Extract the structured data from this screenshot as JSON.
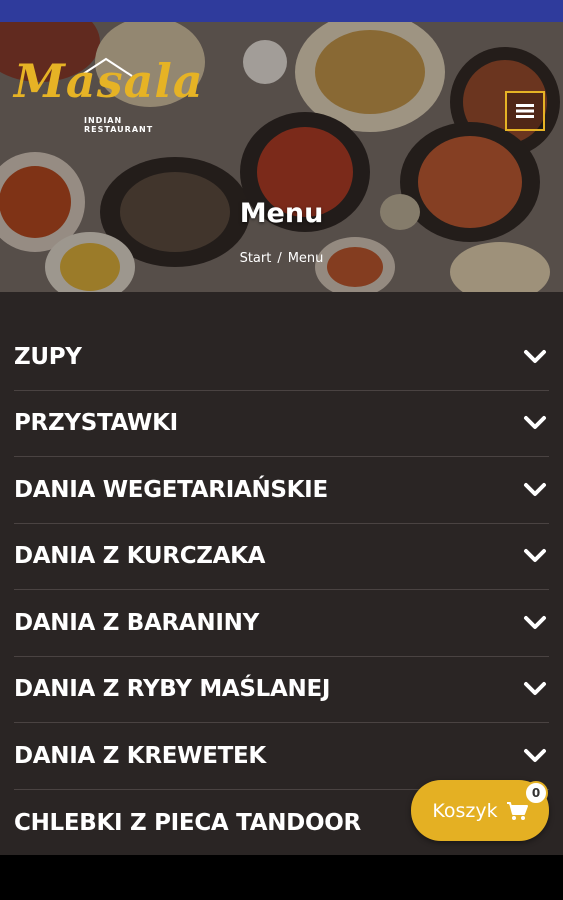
{
  "colors": {
    "accent": "#e4b023",
    "status_bar": "#2f3b9c",
    "menu_background": "#2a2524",
    "divider": "#4a4342"
  },
  "header": {
    "logo_word": "Masala",
    "logo_subtitle": "INDIAN RESTAURANT",
    "menu_icon": "hamburger-icon"
  },
  "hero": {
    "title": "Menu",
    "breadcrumb": {
      "home": "Start",
      "separator": "/",
      "current": "Menu"
    }
  },
  "categories": [
    {
      "label": "ZUPY",
      "icon": "chevron-down-icon"
    },
    {
      "label": "PRZYSTAWKI",
      "icon": "chevron-down-icon"
    },
    {
      "label": "DANIA WEGETARIAŃSKIE",
      "icon": "chevron-down-icon"
    },
    {
      "label": "DANIA Z KURCZAKA",
      "icon": "chevron-down-icon"
    },
    {
      "label": "DANIA Z BARANINY",
      "icon": "chevron-down-icon"
    },
    {
      "label": "DANIA Z RYBY MAŚLANEJ",
      "icon": "chevron-down-icon"
    },
    {
      "label": "DANIA Z KREWETEK",
      "icon": "chevron-down-icon"
    },
    {
      "label": "CHLEBKI Z PIECA TANDOOR",
      "icon": "chevron-down-icon"
    }
  ],
  "cart": {
    "label": "Koszyk",
    "icon": "cart-icon",
    "count": "0"
  }
}
